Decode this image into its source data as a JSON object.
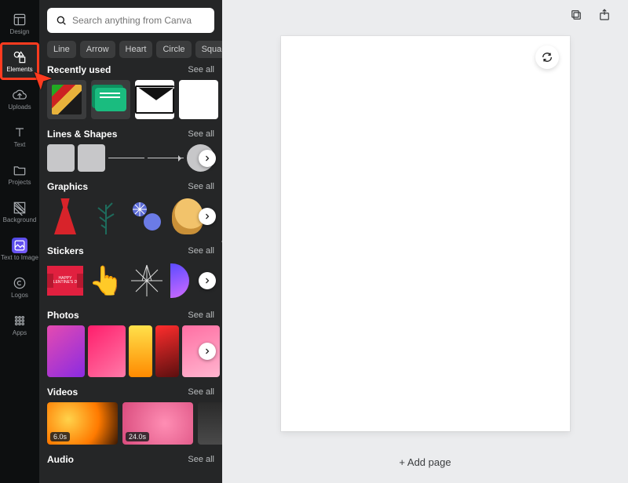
{
  "nav": [
    {
      "id": "design",
      "label": "Design"
    },
    {
      "id": "elements",
      "label": "Elements"
    },
    {
      "id": "uploads",
      "label": "Uploads"
    },
    {
      "id": "text",
      "label": "Text"
    },
    {
      "id": "projects",
      "label": "Projects"
    },
    {
      "id": "background",
      "label": "Background"
    },
    {
      "id": "text-to-image",
      "label": "Text to Image"
    },
    {
      "id": "logos",
      "label": "Logos"
    },
    {
      "id": "apps",
      "label": "Apps"
    }
  ],
  "search": {
    "placeholder": "Search anything from Canva"
  },
  "chips": [
    "Line",
    "Arrow",
    "Heart",
    "Circle",
    "Square"
  ],
  "sections": {
    "recent": {
      "title": "Recently used",
      "seeall": "See all"
    },
    "lines": {
      "title": "Lines & Shapes",
      "seeall": "See all"
    },
    "graphics": {
      "title": "Graphics",
      "seeall": "See all"
    },
    "stickers": {
      "title": "Stickers",
      "seeall": "See all"
    },
    "photos": {
      "title": "Photos",
      "seeall": "See all"
    },
    "videos": {
      "title": "Videos",
      "seeall": "See all"
    },
    "audio": {
      "title": "Audio",
      "seeall": "See all"
    }
  },
  "stickers": {
    "banner_text": "HAPPY VALENTINE'S DAY"
  },
  "videos": [
    {
      "duration": "6.0s"
    },
    {
      "duration": "24.0s"
    }
  ],
  "canvas": {
    "add_page_label": "+ Add page"
  },
  "colors": {
    "panel_bg": "#252627",
    "accent_highlight": "#ff3b1f"
  }
}
